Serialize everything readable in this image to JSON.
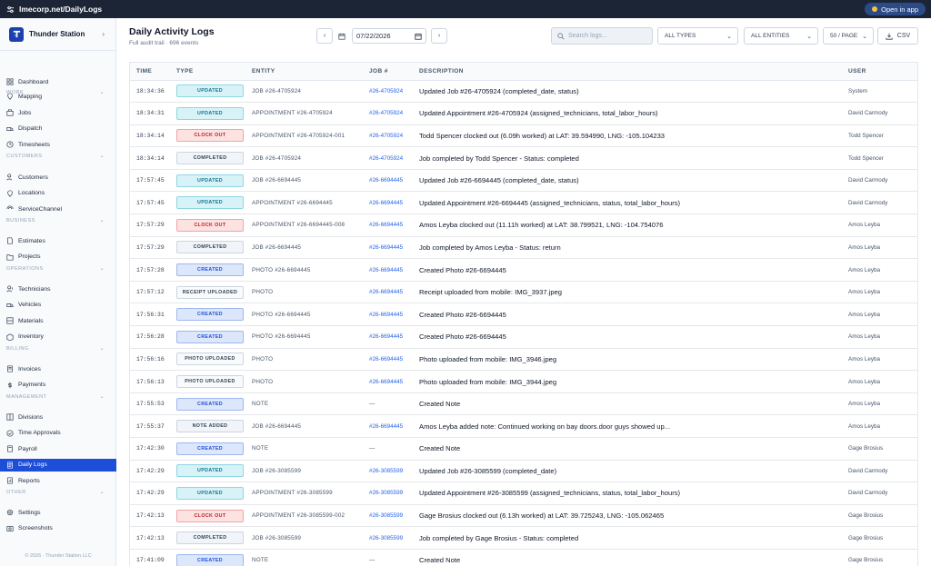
{
  "browser": {
    "url": "lmecorp.net/DailyLogs",
    "open_app": "Open in app"
  },
  "sidebar": {
    "brand": "Thunder Station",
    "dashboard": "Dashboard",
    "mapping": "Mapping",
    "sections": [
      {
        "label": "WORK",
        "items": [
          "Jobs",
          "Dispatch",
          "Timesheets"
        ]
      },
      {
        "label": "CUSTOMERS",
        "items": [
          "Customers",
          "Locations",
          "ServiceChannel"
        ]
      },
      {
        "label": "BUSINESS",
        "items": [
          "Estimates",
          "Projects"
        ]
      },
      {
        "label": "OPERATIONS",
        "items": [
          "Technicians",
          "Vehicles",
          "Materials",
          "Inventory"
        ]
      },
      {
        "label": "BILLING",
        "items": [
          "Invoices",
          "Payments"
        ]
      },
      {
        "label": "MANAGEMENT",
        "items": [
          "Divisions",
          "Time Approvals",
          "Payroll",
          "Daily Logs",
          "Reports"
        ]
      },
      {
        "label": "OTHER",
        "items": [
          "Settings",
          "Screenshots"
        ]
      }
    ],
    "active": "Daily Logs",
    "copyright": "© 2026 · Thunder Station LLC"
  },
  "header": {
    "title": "Daily Activity Logs",
    "subtitle": "Full audit trail · 696 events",
    "date": "07/22/2026",
    "search_placeholder": "Search logs...",
    "type_filter": "ALL TYPES",
    "entity_filter": "ALL ENTITIES",
    "per_page": "50 / PAGE",
    "csv": "CSV"
  },
  "table": {
    "columns": [
      "TIME",
      "TYPE",
      "ENTITY",
      "JOB #",
      "DESCRIPTION",
      "USER"
    ],
    "rows": [
      {
        "time": "18:34:36",
        "type": "UPDATED",
        "entity": "JOB #26-4705924",
        "job": "#26-4705924",
        "desc": "Updated Job #26-4705924 (completed_date, status)",
        "user": "System"
      },
      {
        "time": "18:34:31",
        "type": "UPDATED",
        "entity": "APPOINTMENT #26-4705924",
        "job": "#26-4705924",
        "desc": "Updated Appointment #26-4705924 (assigned_technicians, total_labor_hours)",
        "user": "David Carmody"
      },
      {
        "time": "18:34:14",
        "type": "CLOCK OUT",
        "entity": "APPOINTMENT #26-4705924-001",
        "job": "#26-4705924",
        "desc": "Todd Spencer clocked out (6.09h worked) at LAT: 39.594990, LNG: -105.104233",
        "user": "Todd Spencer"
      },
      {
        "time": "18:34:14",
        "type": "COMPLETED",
        "entity": "JOB #26-4705924",
        "job": "#26-4705924",
        "desc": "Job completed by Todd Spencer - Status: completed",
        "user": "Todd Spencer"
      },
      {
        "time": "17:57:45",
        "type": "UPDATED",
        "entity": "JOB #26-6694445",
        "job": "#26-6694445",
        "desc": "Updated Job #26-6694445 (completed_date, status)",
        "user": "David Carmody"
      },
      {
        "time": "17:57:45",
        "type": "UPDATED",
        "entity": "APPOINTMENT #26-6694445",
        "job": "#26-6694445",
        "desc": "Updated Appointment #26-6694445 (assigned_technicians, status, total_labor_hours)",
        "user": "David Carmody"
      },
      {
        "time": "17:57:29",
        "type": "CLOCK OUT",
        "entity": "APPOINTMENT #26-6694445-008",
        "job": "#26-6694445",
        "desc": "Amos Leyba clocked out (11.11h worked) at LAT: 38.799521, LNG: -104.754076",
        "user": "Amos Leyba"
      },
      {
        "time": "17:57:29",
        "type": "COMPLETED",
        "entity": "JOB #26-6694445",
        "job": "#26-6694445",
        "desc": "Job completed by Amos Leyba - Status: return",
        "user": "Amos Leyba"
      },
      {
        "time": "17:57:28",
        "type": "CREATED",
        "entity": "PHOTO #26-6694445",
        "job": "#26-6694445",
        "desc": "Created Photo #26-6694445",
        "user": "Amos Leyba"
      },
      {
        "time": "17:57:12",
        "type": "RECEIPT UPLOADED",
        "entity": "PHOTO",
        "job": "#26-6694445",
        "desc": "Receipt uploaded from mobile: IMG_3937.jpeg",
        "user": "Amos Leyba"
      },
      {
        "time": "17:56:31",
        "type": "CREATED",
        "entity": "PHOTO #26-6694445",
        "job": "#26-6694445",
        "desc": "Created Photo #26-6694445",
        "user": "Amos Leyba"
      },
      {
        "time": "17:56:28",
        "type": "CREATED",
        "entity": "PHOTO #26-6694445",
        "job": "#26-6694445",
        "desc": "Created Photo #26-6694445",
        "user": "Amos Leyba"
      },
      {
        "time": "17:56:16",
        "type": "PHOTO UPLOADED",
        "entity": "PHOTO",
        "job": "#26-6694445",
        "desc": "Photo uploaded from mobile: IMG_3946.jpeg",
        "user": "Amos Leyba"
      },
      {
        "time": "17:56:13",
        "type": "PHOTO UPLOADED",
        "entity": "PHOTO",
        "job": "#26-6694445",
        "desc": "Photo uploaded from mobile: IMG_3944.jpeg",
        "user": "Amos Leyba"
      },
      {
        "time": "17:55:53",
        "type": "CREATED",
        "entity": "NOTE",
        "job": "—",
        "desc": "Created Note",
        "user": "Amos Leyba"
      },
      {
        "time": "17:55:37",
        "type": "NOTE ADDED",
        "entity": "JOB #26-6694445",
        "job": "#26-6694445",
        "desc": "Amos Leyba added note: Continued working on bay doors.door guys showed up...",
        "user": "Amos Leyba"
      },
      {
        "time": "17:42:30",
        "type": "CREATED",
        "entity": "NOTE",
        "job": "—",
        "desc": "Created Note",
        "user": "Gage Brosius"
      },
      {
        "time": "17:42:29",
        "type": "UPDATED",
        "entity": "JOB #26-3085599",
        "job": "#26-3085599",
        "desc": "Updated Job #26-3085599 (completed_date)",
        "user": "David Carmody"
      },
      {
        "time": "17:42:29",
        "type": "UPDATED",
        "entity": "APPOINTMENT #26-3085599",
        "job": "#26-3085599",
        "desc": "Updated Appointment #26-3085599 (assigned_technicians, status, total_labor_hours)",
        "user": "David Carmody"
      },
      {
        "time": "17:42:13",
        "type": "CLOCK OUT",
        "entity": "APPOINTMENT #26-3085599-002",
        "job": "#26-3085599",
        "desc": "Gage Brosius clocked out (6.13h worked) at LAT: 39.725243, LNG: -105.062465",
        "user": "Gage Brosius"
      },
      {
        "time": "17:42:13",
        "type": "COMPLETED",
        "entity": "JOB #26-3085599",
        "job": "#26-3085599",
        "desc": "Job completed by Gage Brosius - Status: completed",
        "user": "Gage Brosius"
      },
      {
        "time": "17:41:09",
        "type": "CREATED",
        "entity": "NOTE",
        "job": "—",
        "desc": "Created Note",
        "user": "Gage Brosius"
      }
    ]
  },
  "badge_colors": {
    "UPDATED": {
      "bg": "#d8f3f7",
      "border": "#8fd6e3",
      "fg": "#0e7490"
    },
    "CLOCK OUT": {
      "bg": "#fde2e2",
      "border": "#f3a3a3",
      "fg": "#b91c1c"
    },
    "COMPLETED": {
      "bg": "#f1f5f9",
      "border": "#cbd5e1",
      "fg": "#334155"
    },
    "CREATED": {
      "bg": "#dde7fb",
      "border": "#9db7ee",
      "fg": "#1d4ed8"
    },
    "RECEIPT UPLOADED": {
      "bg": "#f8fafc",
      "border": "#cbd5e1",
      "fg": "#334155"
    },
    "PHOTO UPLOADED": {
      "bg": "#f8fafc",
      "border": "#cbd5e1",
      "fg": "#334155"
    },
    "NOTE ADDED": {
      "bg": "#f1f5f9",
      "border": "#cbd5e1",
      "fg": "#334155"
    }
  },
  "accent": "#1d4ed8"
}
